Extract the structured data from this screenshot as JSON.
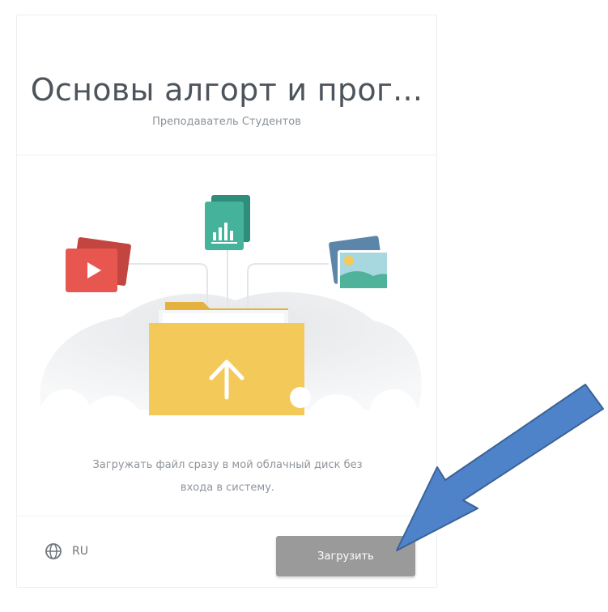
{
  "card": {
    "title": "Основы алгорт и прог...",
    "subtitle": "Преподаватель Студентов",
    "description_line1": "Загружать файл сразу в мой облачный диск без",
    "description_line2": "входа в систему."
  },
  "footer": {
    "language_code": "RU",
    "upload_label": "Загрузить"
  },
  "icons": {
    "language": "globe-icon",
    "video": "video-file-icon",
    "chart": "chart-file-icon",
    "image": "image-file-icon",
    "folder": "folder-upload-icon",
    "annotation": "pointer-arrow"
  },
  "colors": {
    "title": "#4d545c",
    "text_muted": "#8e959c",
    "video_red": "#e8574f",
    "chart_teal": "#45b39c",
    "image_blue": "#5b86a9",
    "folder_yellow": "#f3c95a",
    "button_gray": "#9a9a9a",
    "annotation_blue": "#4f83c9"
  }
}
